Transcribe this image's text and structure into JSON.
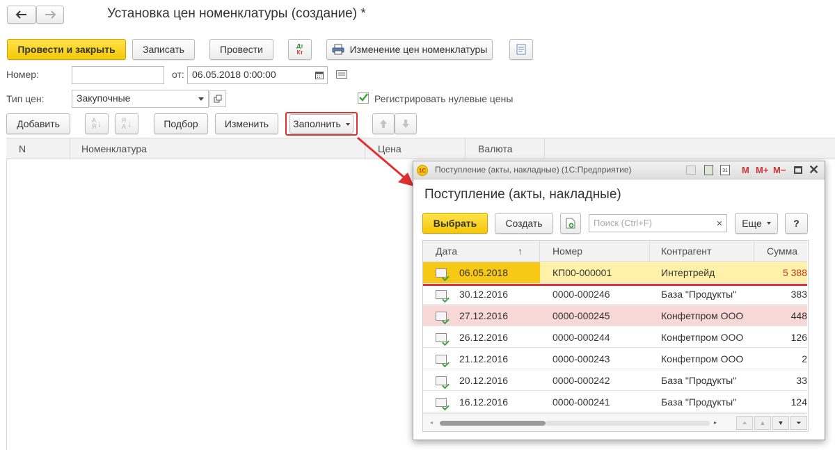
{
  "form": {
    "title": "Установка цен номенклатуры (создание) *",
    "toolbar": {
      "post_close": "Провести и закрыть",
      "save": "Записать",
      "post": "Провести",
      "change_prices": "Изменение цен номенклатуры",
      "dt_kt": "Дт Кт"
    },
    "number": {
      "label": "Номер:",
      "value": ""
    },
    "date": {
      "label": "от:",
      "value": "06.05.2018  0:00:00"
    },
    "price_type": {
      "label": "Тип цен:",
      "value": "Закупочные"
    },
    "register_zero": {
      "label": "Регистрировать нулевые цены",
      "checked": true
    },
    "table_toolbar": {
      "add": "Добавить",
      "pick": "Подбор",
      "edit": "Изменить",
      "fill": "Заполнить"
    },
    "columns": [
      "N",
      "Номенклатура",
      "Цена",
      "Валюта"
    ]
  },
  "dialog": {
    "window_title": "Поступление (акты, накладные) (1С:Предприятие)",
    "title_buttons": [
      "M",
      "M+",
      "M−"
    ],
    "heading": "Поступление (акты, накладные)",
    "select": "Выбрать",
    "create": "Создать",
    "search_placeholder": "Поиск (Ctrl+F)",
    "search_clear": "×",
    "more": "Еще",
    "help": "?",
    "columns": {
      "date": "Дата",
      "sort": "↑",
      "number": "Номер",
      "counterparty": "Контрагент",
      "sum": "Сумма"
    },
    "rows": [
      {
        "date": "06.05.2018",
        "number": "КП00-000001",
        "counterparty": "Интертрейд",
        "sum": "5 388"
      },
      {
        "date": "30.12.2016",
        "number": "0000-000246",
        "counterparty": "База \"Продукты\"",
        "sum": "383"
      },
      {
        "date": "27.12.2016",
        "number": "0000-000245",
        "counterparty": "Конфетпром ООО",
        "sum": "448"
      },
      {
        "date": "26.12.2016",
        "number": "0000-000244",
        "counterparty": "Конфетпром ООО",
        "sum": "126"
      },
      {
        "date": "21.12.2016",
        "number": "0000-000243",
        "counterparty": "Конфетпром ООО",
        "sum": "2"
      },
      {
        "date": "20.12.2016",
        "number": "0000-000242",
        "counterparty": "База \"Продукты\"",
        "sum": "33"
      },
      {
        "date": "16.12.2016",
        "number": "0000-000241",
        "counterparty": "База \"Продукты\"",
        "sum": "124"
      }
    ]
  },
  "colors": {
    "accent_yellow": "#f4c80a",
    "highlight_red": "#e03030",
    "selected_row": "#fff2a8",
    "pink_row": "#f8d7d7"
  }
}
